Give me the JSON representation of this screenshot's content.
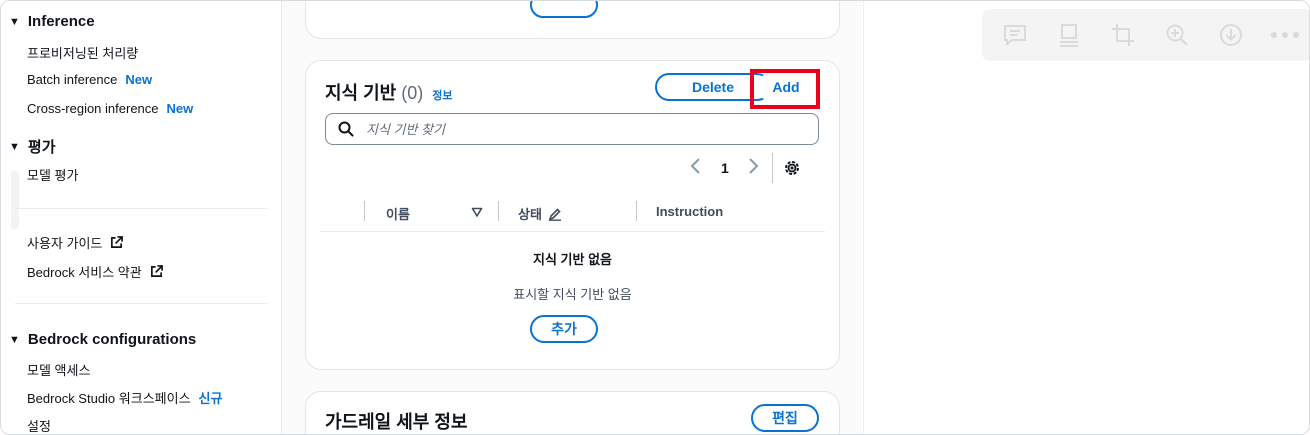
{
  "sidebar": {
    "sections": [
      {
        "title": "Inference",
        "items": [
          {
            "label": "프로비저닝된 처리량"
          },
          {
            "label": "Batch inference",
            "badge": "New"
          },
          {
            "label": "Cross-region inference",
            "badge": "New"
          }
        ]
      },
      {
        "title": "평가",
        "items": [
          {
            "label": "모델 평가"
          }
        ]
      }
    ],
    "links": [
      {
        "label": "사용자 가이드",
        "icon": "external-link-icon"
      },
      {
        "label": "Bedrock 서비스 약관",
        "icon": "external-link-icon"
      }
    ],
    "configurations": {
      "title": "Bedrock configurations",
      "items": [
        {
          "label": "모델 액세스"
        },
        {
          "label": "Bedrock Studio 워크스페이스",
          "badge": "신규"
        },
        {
          "label": "설정"
        }
      ]
    }
  },
  "knowledge_base": {
    "title": "지식 기반",
    "count": "(0)",
    "info_link": "정보",
    "delete_label": "Delete",
    "add_label": "Add",
    "search_placeholder": "지식 기반 찾기",
    "pagination": {
      "current_page": "1"
    },
    "columns": [
      "이름",
      "상태",
      "Instruction"
    ],
    "empty_title": "지식 기반 없음",
    "empty_subtitle": "표시할 지식 기반 없음",
    "create_label": "추가"
  },
  "guardrail": {
    "title": "가드레일 세부 정보",
    "edit_label": "편집"
  },
  "toolbar": {
    "icons": [
      "comment-icon",
      "layout-icon",
      "crop-icon",
      "zoom-in-icon",
      "download-icon",
      "more-icon"
    ]
  },
  "colors": {
    "accent": "#0972d3",
    "highlight": "#e8001c",
    "text": "#0f141a"
  }
}
